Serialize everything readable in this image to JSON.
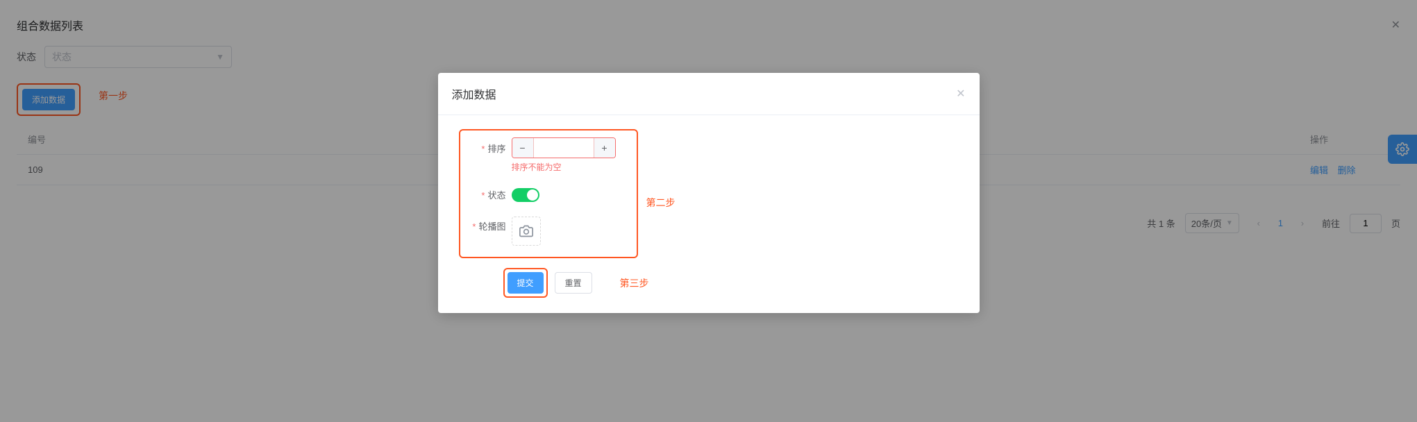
{
  "page": {
    "title": "组合数据列表",
    "filter_label": "状态",
    "filter_placeholder": "状态",
    "add_button": "添加数据",
    "step1_label": "第一步"
  },
  "table": {
    "cols": {
      "id": "编号",
      "op": "操作"
    },
    "rows": [
      {
        "id": "109",
        "edit": "编辑",
        "delete": "删除"
      }
    ]
  },
  "pagination": {
    "total_label": "共 1 条",
    "page_size": "20条/页",
    "current": "1",
    "goto_prefix": "前往",
    "goto_value": "1",
    "goto_suffix": "页"
  },
  "dialog": {
    "title": "添加数据",
    "step2_label": "第二步",
    "step3_label": "第三步",
    "form": {
      "sort_label": "排序",
      "sort_error": "排序不能为空",
      "status_label": "状态",
      "carousel_label": "轮播图"
    },
    "submit": "提交",
    "reset": "重置"
  },
  "icons": {
    "close": "close-icon",
    "arrow_down": "chevron-down-icon",
    "minus": "minus-icon",
    "plus": "plus-icon",
    "camera": "camera-icon",
    "gear": "gear-icon",
    "prev": "chevron-left-icon",
    "next": "chevron-right-icon"
  }
}
